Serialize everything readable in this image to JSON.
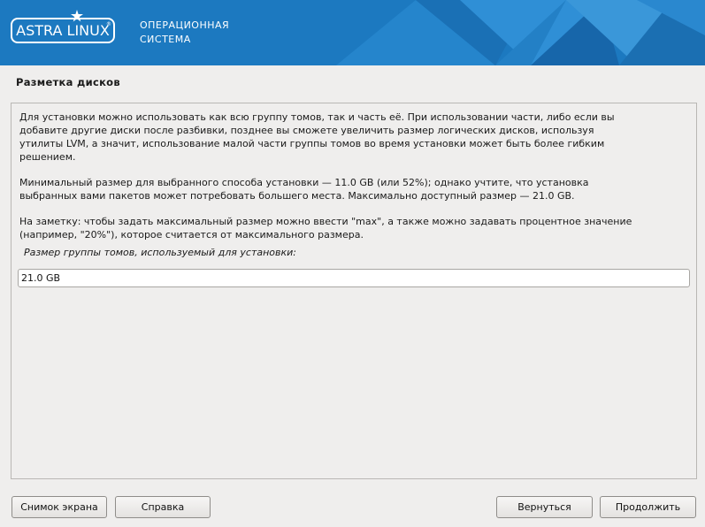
{
  "header": {
    "logo_text": "ASTRA LINUX",
    "logo_reg": "®",
    "subtitle_line1": "ОПЕРАЦИОННАЯ",
    "subtitle_line2": "СИСТЕМА",
    "colors": {
      "background": "#1c79c0",
      "facet_light": "#3a97d9",
      "facet_dark": "#1466a8"
    }
  },
  "page": {
    "title": "Разметка дисков"
  },
  "content": {
    "paragraph1_lines": [
      "Для установки можно использовать как всю группу томов, так и часть её. При использовании части, либо если вы",
      "добавите другие диски после разбивки, позднее вы сможете увеличить размер логических дисков, используя",
      "утилиты LVM, а значит, использование малой части группы томов во время установки может быть более гибким",
      "решением."
    ],
    "paragraph2_lines": [
      "Минимальный размер для выбранного способа установки — 11.0 GB (или 52%); однако учтите, что установка",
      "выбранных вами пакетов может потребовать большего места. Максимально доступный размер — 21.0 GB."
    ],
    "paragraph3_lines": [
      "На заметку: чтобы задать максимальный размер можно ввести \"max\", а также можно задавать процентное значение",
      "(например, \"20%\"), которое считается от максимального размера."
    ],
    "field_label": "Размер группы томов, используемый для установки:",
    "field_value": "21.0 GB"
  },
  "buttons": {
    "screenshot": "Снимок экрана",
    "help": "Справка",
    "back": "Вернуться",
    "continue": "Продолжить"
  }
}
